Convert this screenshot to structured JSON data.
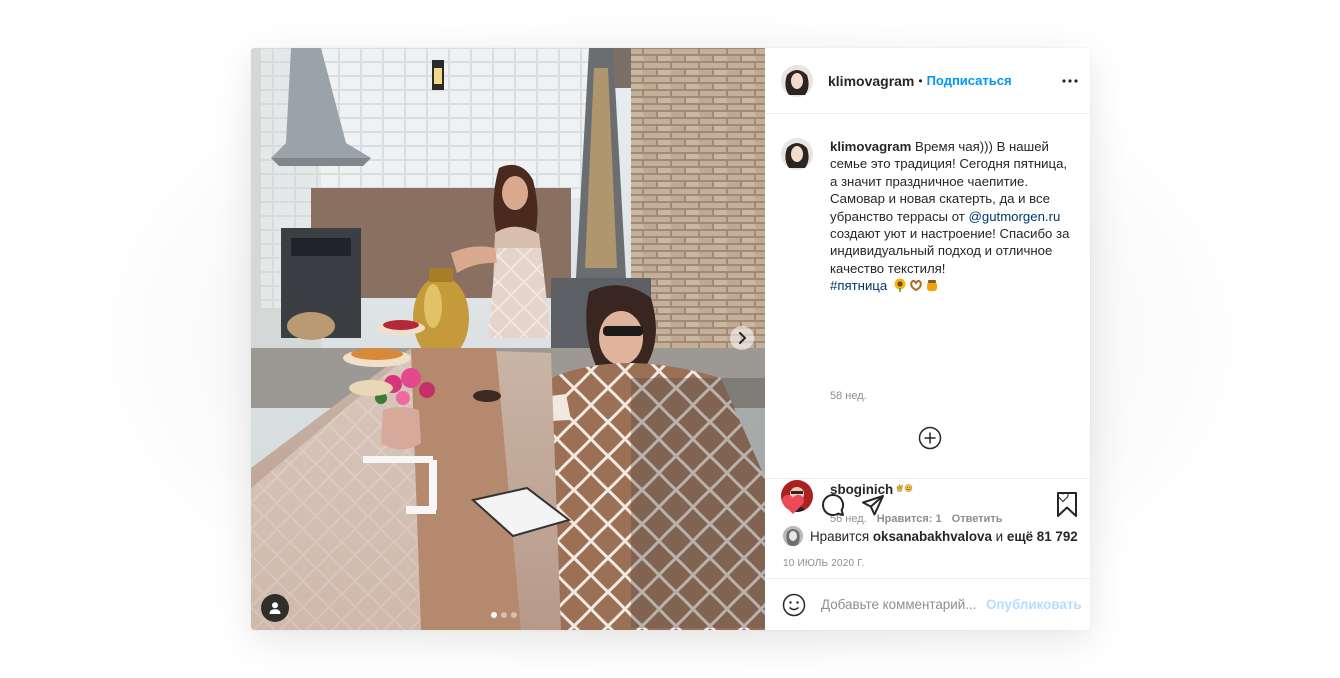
{
  "post": {
    "author": "klimovagram",
    "separator": "•",
    "follow_label": "Подписаться",
    "more_label": "•••",
    "caption": {
      "username": "klimovagram",
      "text_before_mention": "Время чая))) В нашей семье это традиция! Сегодня пятница, а значит праздничное чаепитие. Самовар и новая скатерть, да и все убранство террасы от",
      "mention": "@gutmorgen.ru",
      "text_after_mention": "создают уют и настроение! Спасибо за индивидуальный подход и отличное качество текстиля!",
      "hashtag": "#пятница",
      "emoji": "🌻🥨🍯",
      "age": "58 нед."
    },
    "comments": [
      {
        "username": "sboginich",
        "text": "✌️🙂",
        "age": "56 нед.",
        "likes_label": "Нравится: 1",
        "reply_label": "Ответить"
      }
    ],
    "likes": {
      "prefix": "Нравится",
      "user": "oksanabakhvalova",
      "and": "и",
      "others": "ещё 81 792"
    },
    "date": "10 ИЮЛЬ 2020 Г.",
    "add_comment": {
      "placeholder": "Добавьте комментарий...",
      "publish_label": "Опубликовать"
    },
    "carousel": {
      "total": 3,
      "active": 1
    },
    "colors": {
      "accent": "#0095f6",
      "like_red": "#ed4956",
      "muted": "#8e8e8e",
      "publish_disabled": "#b2dffc"
    }
  }
}
